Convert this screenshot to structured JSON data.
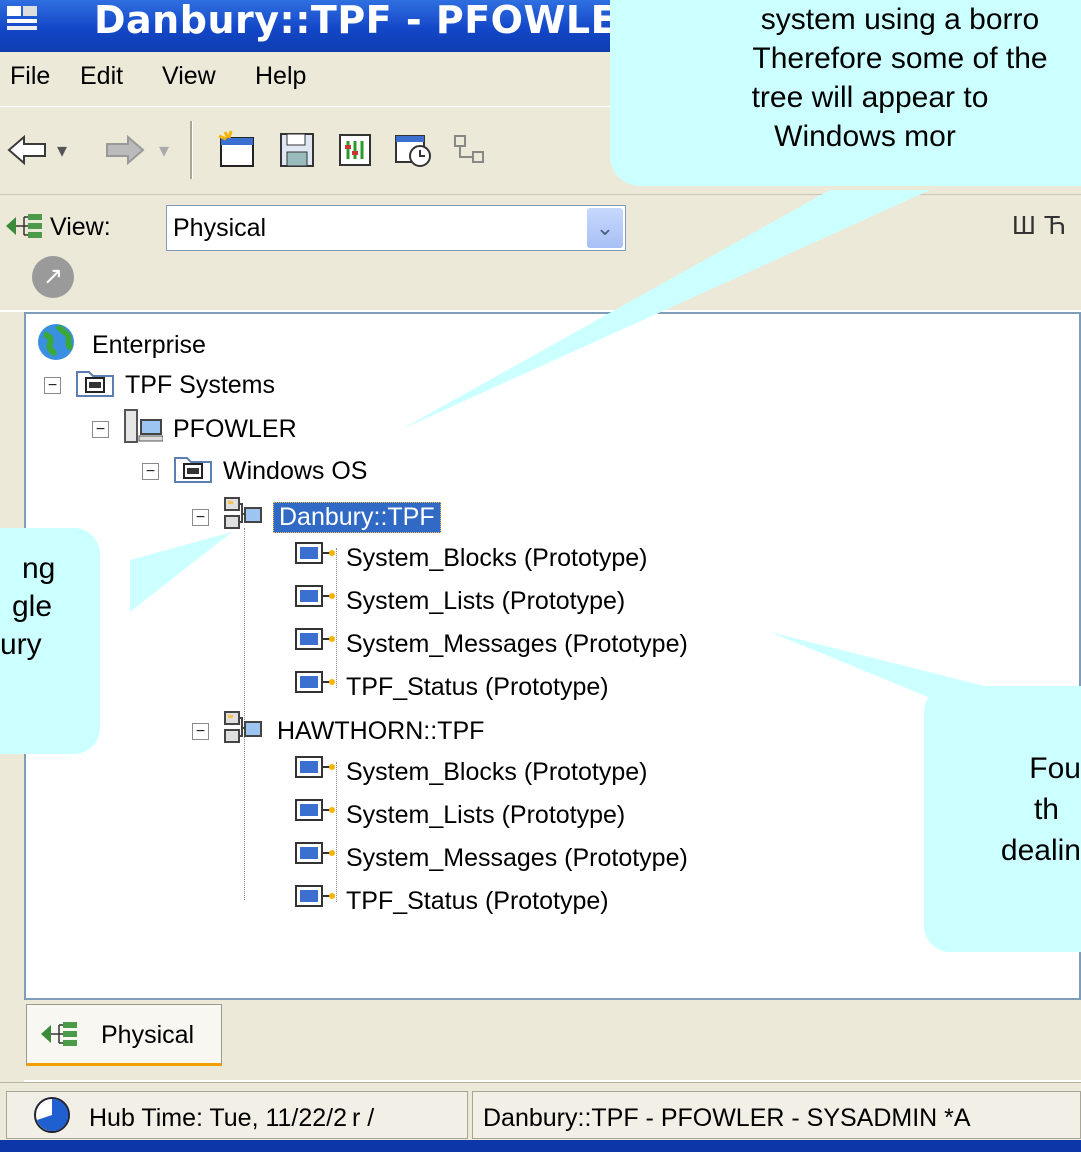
{
  "window": {
    "title": "Danbury::TPF - PFOWLER - SYSA"
  },
  "menubar": {
    "items": [
      "File",
      "Edit",
      "View",
      "Help"
    ]
  },
  "view": {
    "label": "View:",
    "selected": "Physical"
  },
  "tree": {
    "root": "Enterprise",
    "systems": "TPF Systems",
    "host": "PFOWLER",
    "os": "Windows OS",
    "danbury": {
      "label": "Danbury::TPF",
      "children": [
        "System_Blocks (Prototype)",
        "System_Lists (Prototype)",
        "System_Messages (Prototype)",
        "TPF_Status (Prototype)"
      ]
    },
    "hawthorn": {
      "label": "HAWTHORN::TPF",
      "children": [
        "System_Blocks (Prototype)",
        "System_Lists (Prototype)",
        "System_Messages (Prototype)",
        "TPF_Status (Prototype)"
      ]
    }
  },
  "bottom_tab": {
    "label": "Physical"
  },
  "status": {
    "hub_time": "Hub Time: Tue, 11/22/2 r /",
    "context": "Danbury::TPF - PFOWLER - SYSADMIN   *A"
  },
  "callouts": {
    "top": [
      "system using a borro",
      "Therefore some of the",
      "tree will appear to",
      "Windows mor"
    ],
    "left": [
      "ng",
      "gle",
      "ury"
    ],
    "right": [
      "Fou",
      "th",
      "dealin"
    ]
  },
  "colors": {
    "callout": "#ccffff",
    "title_bar": "#1347c8",
    "selection": "#316ac5",
    "chrome": "#ece9d8"
  }
}
